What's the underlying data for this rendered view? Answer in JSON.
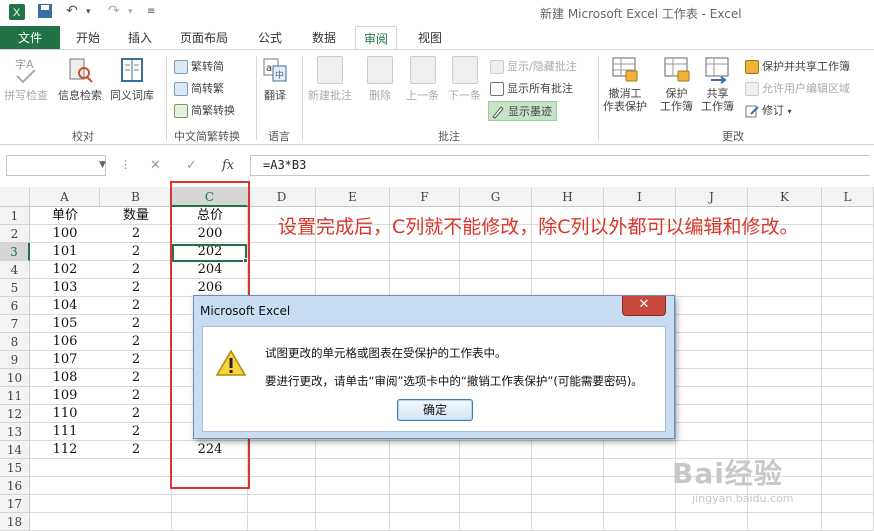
{
  "app": {
    "title": "新建 Microsoft Excel 工作表 - Excel"
  },
  "tabs": {
    "file": "文件",
    "home": "开始",
    "insert": "插入",
    "layout": "页面布局",
    "formulas": "公式",
    "data": "数据",
    "review": "审阅",
    "view": "视图"
  },
  "ribbon": {
    "proofing": {
      "spell": "拼写检查",
      "research": "信息检索",
      "thesaurus": "同义词库",
      "group": "校对"
    },
    "chinese": {
      "to_trad": "繁转简",
      "to_simp": "简转繁",
      "convert": "简繁转换",
      "group": "中文简繁转换"
    },
    "language": {
      "translate": "翻译",
      "group": "语言"
    },
    "comments": {
      "new": "新建批注",
      "delete": "删除",
      "prev": "上一条",
      "next": "下一条",
      "show_hide": "显示/隐藏批注",
      "show_all": "显示所有批注",
      "show_ink": "显示墨迹",
      "group": "批注"
    },
    "changes": {
      "unprotect_l1": "撤消工",
      "unprotect_l2": "作表保护",
      "protect_l1": "保护",
      "protect_l2": "工作簿",
      "share_l1": "共享",
      "share_l2": "工作簿",
      "protect_share": "保护并共享工作簿",
      "allow_edit": "允许用户编辑区域",
      "track": "修订",
      "group": "更改"
    }
  },
  "formula_bar": {
    "namebox": "",
    "fx": "fx",
    "formula": "=A3*B3"
  },
  "grid": {
    "columns": [
      "A",
      "B",
      "C",
      "D",
      "E",
      "F",
      "G",
      "H",
      "I",
      "J",
      "K",
      "L"
    ],
    "rows": [
      "1",
      "2",
      "3",
      "4",
      "5",
      "6",
      "7",
      "8",
      "9",
      "10",
      "11",
      "12",
      "13",
      "14",
      "15",
      "16",
      "17",
      "18"
    ],
    "cells": [
      [
        "单价",
        "数量",
        "总价"
      ],
      [
        "100",
        "2",
        "200"
      ],
      [
        "101",
        "2",
        "202"
      ],
      [
        "102",
        "2",
        "204"
      ],
      [
        "103",
        "2",
        "206"
      ],
      [
        "104",
        "2",
        ""
      ],
      [
        "105",
        "2",
        ""
      ],
      [
        "106",
        "2",
        ""
      ],
      [
        "107",
        "2",
        ""
      ],
      [
        "108",
        "2",
        ""
      ],
      [
        "109",
        "2",
        ""
      ],
      [
        "110",
        "2",
        ""
      ],
      [
        "111",
        "2",
        ""
      ],
      [
        "112",
        "2",
        "224"
      ]
    ]
  },
  "annotation": "设置完成后，C列就不能修改，除C列以外都可以编辑和修改。",
  "dialog": {
    "title": "Microsoft Excel",
    "line1": "试图更改的单元格或图表在受保护的工作表中。",
    "line2": "要进行更改，请单击“审阅”选项卡中的“撤销工作表保护”(可能需要密码)。",
    "ok": "确定",
    "close": "✕"
  },
  "watermark": {
    "brand": "Bai经验",
    "url": "jingyan.baidu.com"
  },
  "colors": {
    "excel_green": "#217346",
    "annotation_red": "#d9362b"
  }
}
